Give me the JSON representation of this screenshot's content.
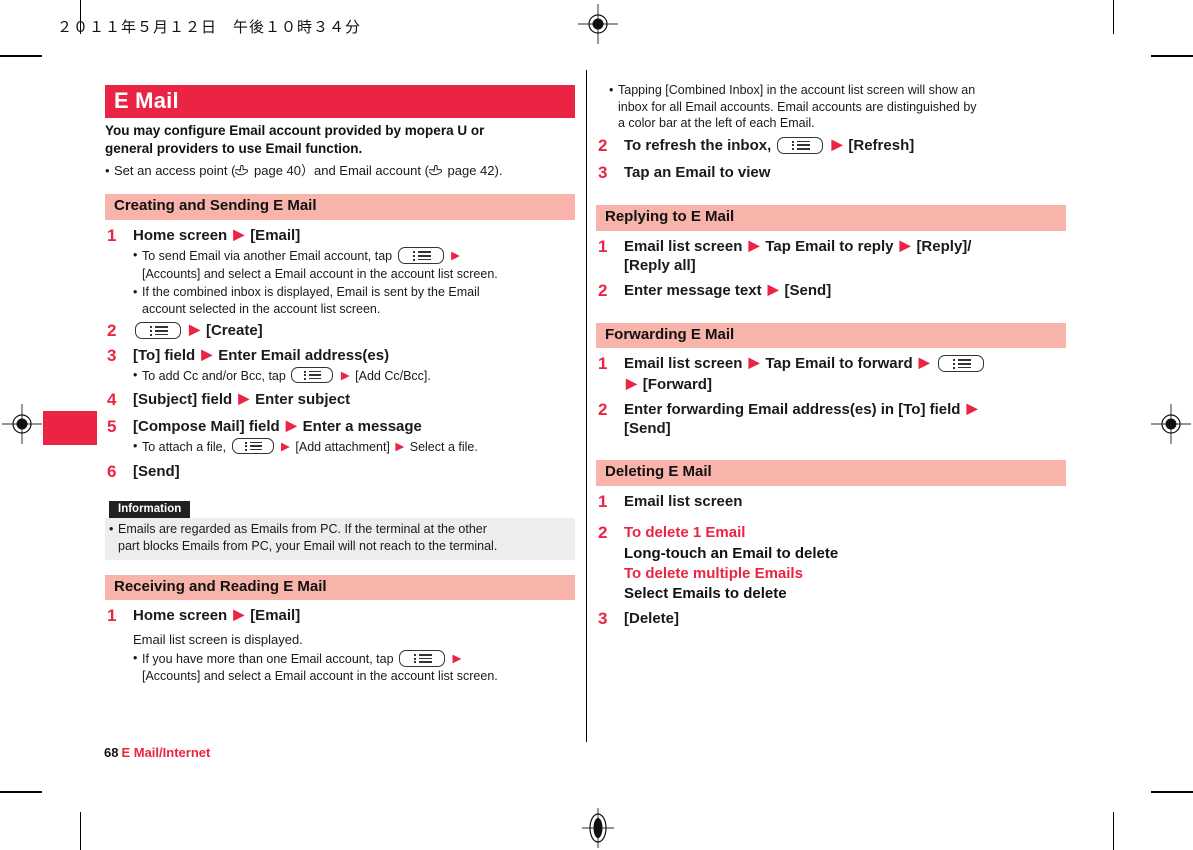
{
  "page": {
    "date_line": "２０１１年５月１２日　午後１０時３４分",
    "footer_page_number": "68",
    "footer_title": "E Mail/Internet",
    "accent_red": "#EA2442",
    "section_pink": "#F8B3AA",
    "info_gray": "#EDEDED",
    "info_label_bg": "#221F20"
  },
  "title_bar": {
    "text": "E Mail"
  },
  "lead": {
    "line1": "You may configure Email account provided by mopera U or",
    "line2": "general providers to use Email function.",
    "bullet": "Set an access point (",
    "bullet_mid": " page 40）and Email account (",
    "bullet_end": " page 42)."
  },
  "sections": {
    "creating": {
      "heading": "Creating and Sending E Mail",
      "steps": [
        {
          "num": "1",
          "title_a": "Home screen",
          "title_b": "[Email]",
          "bullets": [
            {
              "a": "To send Email via another Email account, tap",
              "b": "",
              "c": "[Accounts] and select a Email account in the account list screen."
            },
            {
              "a": "If the combined inbox is displayed, Email is sent by the Email",
              "c": "account selected in the account list screen."
            }
          ]
        },
        {
          "num": "2",
          "title_b": "[Create]"
        },
        {
          "num": "3",
          "title_a": "[To] field",
          "title_b": "Enter Email address(es)",
          "bullets": [
            {
              "a": "To add Cc and/or Bcc, tap",
              "c": "[Add Cc/Bcc]."
            }
          ]
        },
        {
          "num": "4",
          "title_a": "[Subject] field",
          "title_b": "Enter subject"
        },
        {
          "num": "5",
          "title_a": "[Compose Mail] field",
          "title_b": "Enter a message",
          "bullets": [
            {
              "a": "To attach a file,",
              "c": "[Add attachment]",
              "d": "Select a file."
            }
          ]
        },
        {
          "num": "6",
          "title_b": "[Send]"
        }
      ]
    },
    "information": {
      "label": "Information",
      "bullet_l1": "Emails are regarded as Emails from PC. If the terminal at the other",
      "bullet_l2": "part blocks Emails from PC, your Email will not reach to the terminal."
    },
    "receiving": {
      "heading": "Receiving and Reading E Mail",
      "step1_num": "1",
      "step1_a": "Home screen",
      "step1_b": "[Email]",
      "step1_note": "Email list screen is displayed.",
      "step1_bullet_a": "If you have more than one Email account, tap",
      "step1_bullet_c": "[Accounts] and select a Email account in the account list screen.",
      "cont_bullet_l1": "Tapping [Combined Inbox] in the account list screen will show an",
      "cont_bullet_l2": "inbox for all Email accounts. Email accounts are distinguished by",
      "cont_bullet_l3": "a color bar at the left of each Email.",
      "step2_num": "2",
      "step2_a": "To refresh the inbox,",
      "step2_b": "[Refresh]",
      "step3_num": "3",
      "step3_a": "Tap an Email to view"
    },
    "replying": {
      "heading": "Replying to E Mail",
      "step1_num": "1",
      "step1_a": "Email list screen",
      "step1_b": "Tap Email to reply",
      "step1_c": "[Reply]/",
      "step1_d": "[Reply all]",
      "step2_num": "2",
      "step2_a": "Enter message text",
      "step2_b": "[Send]"
    },
    "forwarding": {
      "heading": "Forwarding E Mail",
      "step1_num": "1",
      "step1_a": "Email list screen",
      "step1_b": "Tap Email to forward",
      "step1_c": "[Forward]",
      "step2_num": "2",
      "step2_a": "Enter forwarding Email address(es) in [To] field",
      "step2_b": "[Send]"
    },
    "deleting": {
      "heading": "Deleting E Mail",
      "step1_num": "1",
      "step1_a": "Email list screen",
      "step2_num": "2",
      "step2_red1": "To delete 1 Email",
      "step2_blk1": "Long-touch an Email to delete",
      "step2_red2": "To delete multiple Emails",
      "step2_blk2": "Select Emails to delete",
      "step3_num": "3",
      "step3_a": "[Delete]"
    }
  },
  "glyphs": {
    "arrow": "▶",
    "bullet": "•"
  }
}
